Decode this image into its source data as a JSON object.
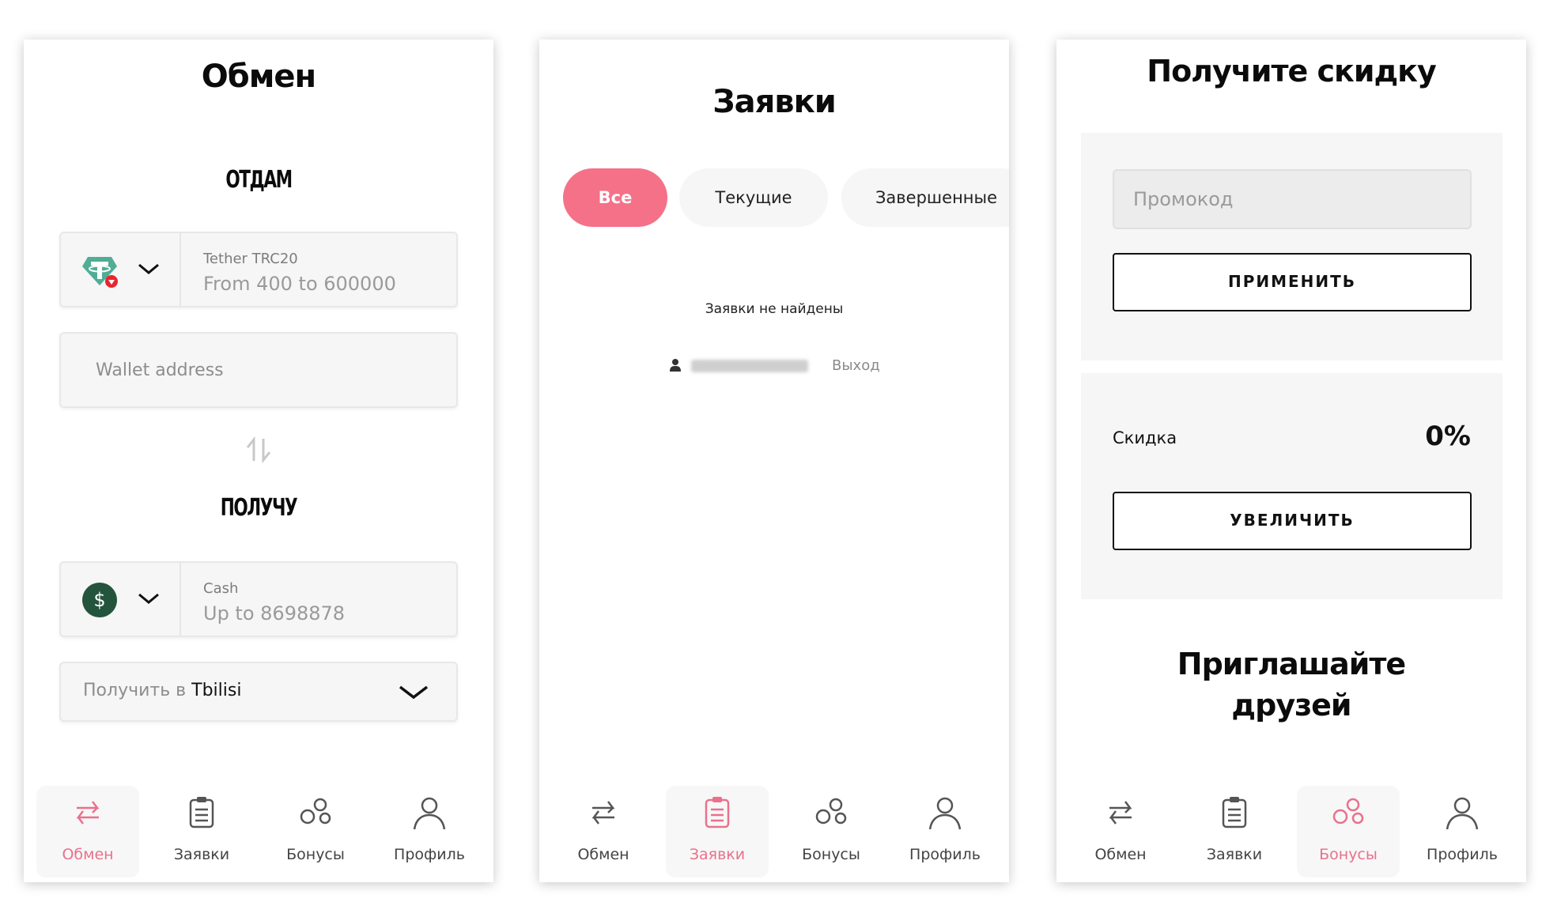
{
  "exchange": {
    "title": "Обмен",
    "give_label": "ОТДАМ",
    "give_currency": {
      "name": "Tether TRC20",
      "range": "From 400 to 600000",
      "icon": "tether-icon"
    },
    "wallet_placeholder": "Wallet address",
    "receive_label": "ПОЛУЧУ",
    "receive_currency": {
      "name": "Cash",
      "range": "Up to 8698878",
      "icon": "dollar-icon"
    },
    "city_prefix": "Получить в",
    "city_value": "Tbilisi"
  },
  "orders": {
    "title": "Заявки",
    "tabs": [
      "Все",
      "Текущие",
      "Завершенные"
    ],
    "empty_message": "Заявки не найдены",
    "logout_label": "Выход"
  },
  "bonuses": {
    "title": "Получите скидку",
    "promo_placeholder": "Промокод",
    "apply_label": "ПРИМЕНИТЬ",
    "discount_label": "Скидка",
    "discount_value": "0%",
    "increase_label": "УВЕЛИЧИТЬ",
    "invite_title_line1": "Приглашайте",
    "invite_title_line2": "друзей"
  },
  "nav": {
    "exchange": "Обмен",
    "orders": "Заявки",
    "bonuses": "Бонусы",
    "profile": "Профиль"
  },
  "colors": {
    "accent_pink": "#f57188",
    "tether_green": "#4fae95",
    "cash_green": "#24553c"
  }
}
